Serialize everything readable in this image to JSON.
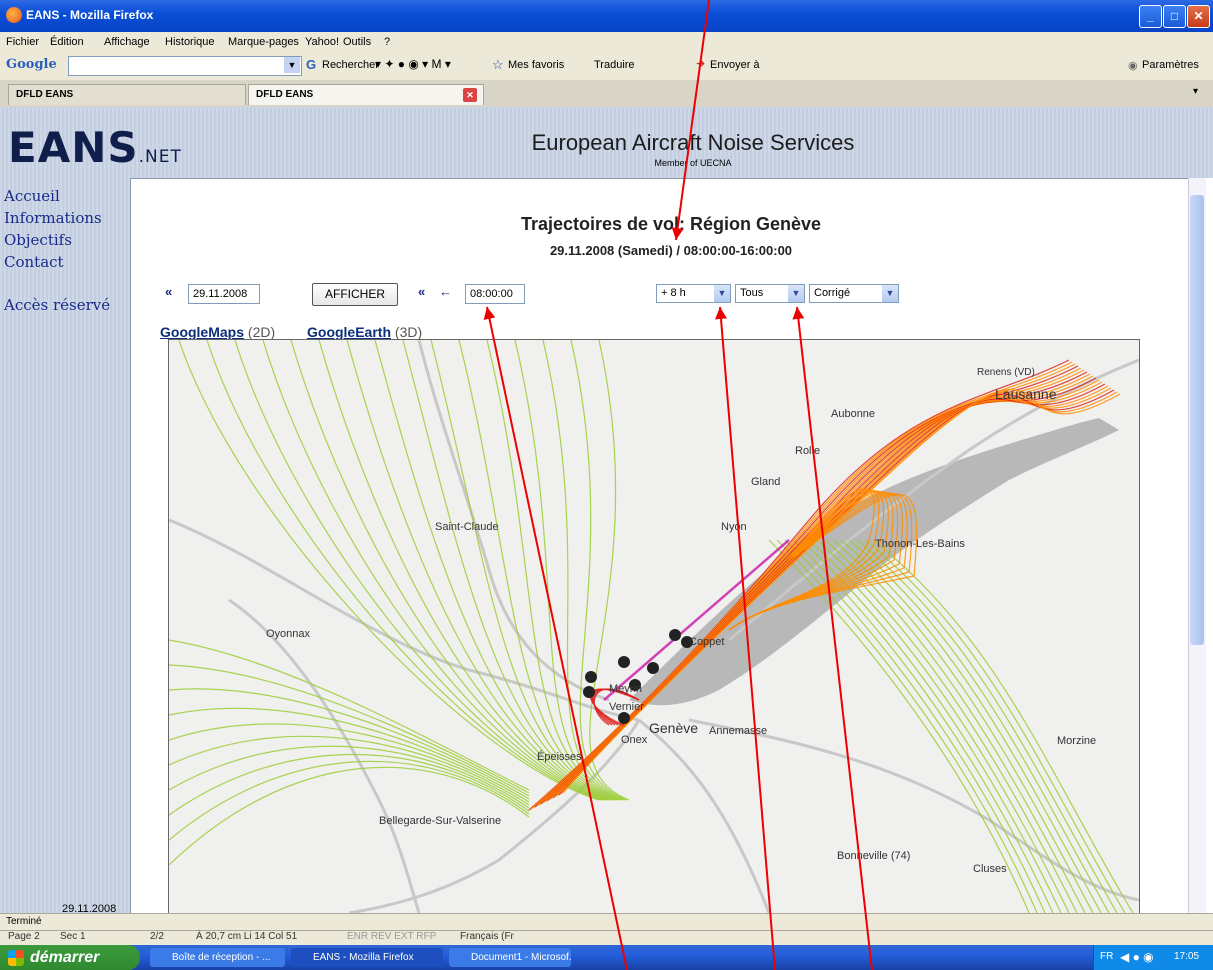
{
  "window": {
    "title": "EANS - Mozilla Firefox"
  },
  "menu": [
    "Fichier",
    "Édition",
    "Affichage",
    "Historique",
    "Marque-pages",
    "Yahoo!",
    "Outils",
    "?"
  ],
  "toolbar": {
    "google_label": "Google",
    "search_label": "Rechercher",
    "favoris": "Mes favoris",
    "traduire": "Traduire",
    "envoyer": "Envoyer à",
    "parametres": "Paramètres"
  },
  "tabs": [
    {
      "label": "DFLD EANS",
      "active": false
    },
    {
      "label": "DFLD EANS",
      "active": true
    }
  ],
  "site": {
    "logo": "EANS",
    "logo_suffix": ".NET",
    "title": "European Aircraft Noise Services",
    "subtitle": "Member of UECNA",
    "nav": [
      "Accueil",
      "Informations",
      "Objectifs",
      "Contact",
      "Accès réservé"
    ],
    "nav_date": "29.11.2008"
  },
  "content": {
    "title": "Trajectoires de vol: Région Genève",
    "date_line": "29.11.2008 (Samedi) / 08:00:00-16:00:00",
    "date_value": "29.11.2008",
    "afficher": "AFFICHER",
    "time_value": "08:00:00",
    "duration_value": "+ 8 h",
    "filter_value": "Tous",
    "mode_value": "Corrigé",
    "gmaps_label": "GoogleMaps",
    "gmaps_suffix": "(2D)",
    "gearth_label": "GoogleEarth",
    "gearth_suffix": "(3D)"
  },
  "map": {
    "places": [
      "Renens (VD)",
      "Lausanne",
      "Aubonne",
      "Rolle",
      "Gland",
      "Saint-Claude",
      "Nyon",
      "Thonon-Les-Bains",
      "Oyonnax",
      "Coppet",
      "Meyrin",
      "Vernier",
      "Onex",
      "Genève",
      "Annemasse",
      "Épeisses",
      "Morzine",
      "Bellegarde-Sur-Valserine",
      "Bonneville (74)",
      "Cluses"
    ],
    "colors": {
      "track_green": "#9acd32",
      "track_orange": "#ff8c00",
      "track_red": "#e02020",
      "track_magenta": "#cc22aa"
    }
  },
  "status": {
    "text": "Terminé"
  },
  "wordbar": {
    "page": "Page 2",
    "section": "Sec 1",
    "pages": "2/2",
    "position": "À 20,7 cm  Li 14   Col 51",
    "modes": "ENR  RÉV  EXT  RFP",
    "language": "Français (Fr"
  },
  "taskbar": {
    "start": "démarrer",
    "items": [
      "Boîte de réception - ...",
      "EANS - Mozilla Firefox",
      "Document1 - Microsof..."
    ],
    "lang": "FR",
    "clock": "17:05"
  }
}
